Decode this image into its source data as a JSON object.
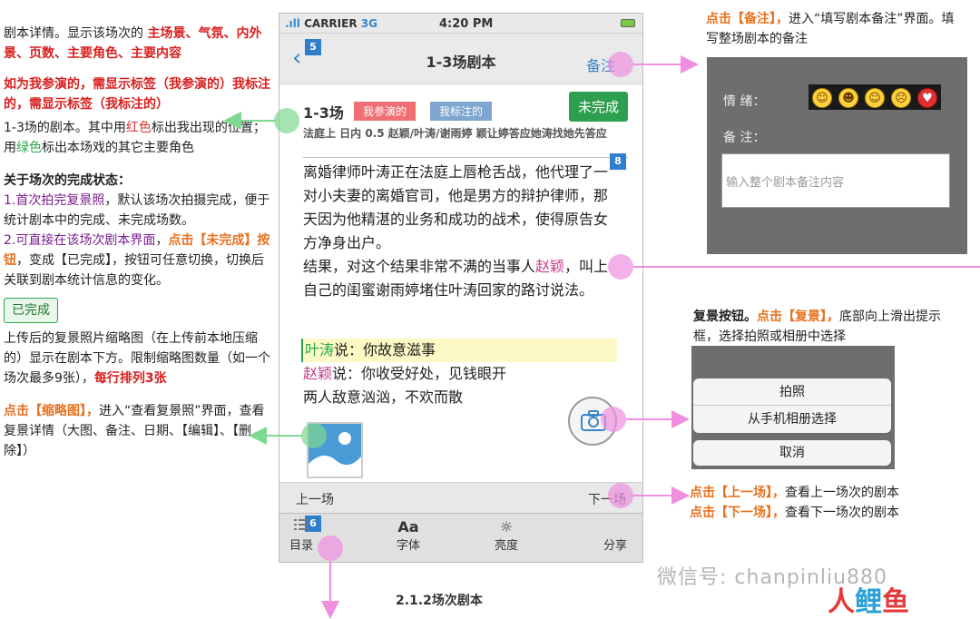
{
  "left": {
    "p1_a": "剧本详情。显示该场次的 ",
    "p1_b": "主场景、气氛、内外景、页数、主要角色、主要内容",
    "p2": "如为我参演的，需显示标签（我参演的）我标注的，需显示标签（我标注的）",
    "p3_a": "1-3场的剧本。其中用",
    "p3_red": "红色",
    "p3_b": "标出我出现的位置；用",
    "p3_green": "绿色",
    "p3_c": "标出本场戏的其它主要角色",
    "p4_title": "关于场次的完成状态：",
    "p4_1a": "1.首次拍完复景照",
    "p4_1b": "，默认该场次拍摄完成，便于统计剧本中的完成、未完成场数。",
    "p4_2a": "2.可直接在该场次剧本界面",
    "p4_2b": "，",
    "p4_2c": "点击【未完成】按钮",
    "p4_2d": "，变成【已完成】，按钮可任意切换，切换后关联到剧本统计信息的变化。",
    "done_chip": "已完成",
    "p5_a": "上传后的复景照片缩略图（在上传前本地压缩的）显示在剧本下方。限制缩略图数量（如一个场次最多9张），",
    "p5_b": "每行排列3张",
    "p6_a": "点击【缩略图】，",
    "p6_b": "进入“查看复景照”界面，查看复景详情（大图、备注、日期、【编辑】、【删除】）"
  },
  "phone": {
    "carrier": "CARRIER",
    "network": "3G",
    "time": "4:20 PM",
    "title": "1-3场剧本",
    "note_btn": "备注",
    "badge5": "5",
    "badge6": "6",
    "badge8": "8",
    "scene": "1-3场",
    "tag_mine": "我参演的",
    "tag_marked": "我标注的",
    "status_btn": "未完成",
    "meta": "法庭上  日内  0.5  赵颖/叶涛/谢雨婷  颖让婷答应她涛找她先答应",
    "script_a": "离婚律师叶涛正在法庭上唇枪舌战，他代理了一对小夫妻的离婚官司，他是男方的辩护律师，那天因为他精湛的业务和成功的战术，使得原告女方净身出户。",
    "script_b": "结果，对这个结果非常不满的当事人",
    "script_name": "赵颖",
    "script_c": "，叫上自己的闺蜜谢雨婷堵住叶涛回家的路讨说法。",
    "d1_name": "叶涛",
    "d1_text": "说：你故意滋事",
    "d2_name": "赵颖",
    "d2_text": "说：你收受好处，见钱眼开",
    "d3": "两人敌意汹汹，不欢而散",
    "prev": "上一场",
    "next": "下一场",
    "tabs": [
      {
        "icon": "",
        "label": "目录"
      },
      {
        "icon": "Aa",
        "label": "字体"
      },
      {
        "icon": "☼",
        "label": "亮度"
      },
      {
        "icon": "",
        "label": "分享"
      }
    ]
  },
  "right": {
    "note_a": "点击【备注】，",
    "note_b": "进入“填写剧本备注”界面。填写整场剧本的备注",
    "panel_mood": "情    绪：",
    "panel_note": "备    注：",
    "panel_placeholder": "输入整个剧本备注内容",
    "photo_a": "复景按钮。",
    "photo_b": "点击【复景】，",
    "photo_c": "底部向上滑出提示框，选择拍照或相册中选择",
    "take_photo": "拍照",
    "from_album": "从手机相册选择",
    "cancel": "取消",
    "prev_a": "点击【上一场】，",
    "prev_b": "查看上一场次的剧本",
    "next_a": "点击【下一场】，",
    "next_b": "查看下一场次的剧本",
    "watermark": "微信号: chanpinliu880",
    "logo_a": "人",
    "logo_b": "鲤",
    "logo_c": "鱼",
    "caption": "2.1.2场次剧本"
  },
  "colors": {
    "accent_blue": "#3a86c7",
    "green": "#2e9e4f",
    "red": "#d91e1e",
    "orange": "#e8711f",
    "pink_arrow": "#f08ee0",
    "green_arrow": "#7fd88f"
  }
}
